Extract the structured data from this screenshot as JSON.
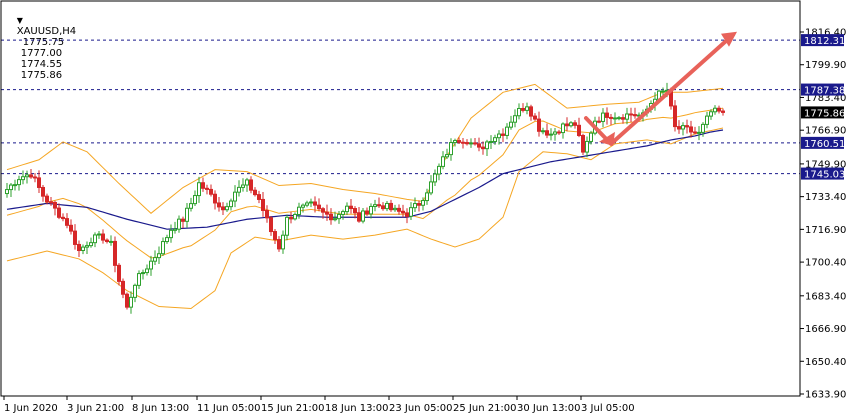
{
  "header": {
    "symbol": "XAUUSD,H4",
    "open": "1775.75",
    "high": "1777.00",
    "low": "1774.55",
    "close": "1775.86",
    "dropdown_glyph": "▼"
  },
  "colors": {
    "background": "#ffffff",
    "axis": "#000000",
    "bull": "#2ca02c",
    "bear": "#d62728",
    "bollinger": "#f5a623",
    "moving_average": "#1a1a8c",
    "level_line": "#1a1a8c",
    "level_label_bg": "#1a1a8c",
    "current_label_bg": "#000000",
    "arrow": "#e8625a"
  },
  "chart_data": {
    "type": "candlestick",
    "symbol": "XAUUSD",
    "timeframe": "H4",
    "ylim": [
      1633.9,
      1816.4
    ],
    "y_ticks": [
      "1816.40",
      "1799.90",
      "1783.40",
      "1766.90",
      "1749.90",
      "1733.40",
      "1716.90",
      "1700.40",
      "1683.40",
      "1666.90",
      "1650.40",
      "1633.90"
    ],
    "x_ticks": [
      "1 Jun 2020",
      "3 Jun 21:00",
      "8 Jun 13:00",
      "11 Jun 05:00",
      "15 Jun 21:00",
      "18 Jun 13:00",
      "23 Jun 05:00",
      "25 Jun 21:00",
      "30 Jun 13:00",
      "3 Jul 05:00"
    ],
    "levels": [
      {
        "value": 1812.31,
        "label": "1812.31"
      },
      {
        "value": 1787.38,
        "label": "1787.38"
      },
      {
        "value": 1760.51,
        "label": "1760.51"
      },
      {
        "value": 1745.03,
        "label": "1745.03"
      }
    ],
    "current_price": {
      "value": 1775.86,
      "label": "1775.86"
    },
    "close_anchors": [
      [
        0,
        1737
      ],
      [
        3,
        1743
      ],
      [
        6,
        1745
      ],
      [
        9,
        1734
      ],
      [
        12,
        1727
      ],
      [
        15,
        1720
      ],
      [
        18,
        1706
      ],
      [
        21,
        1712
      ],
      [
        24,
        1713
      ],
      [
        26,
        1709
      ],
      [
        28,
        1691
      ],
      [
        30,
        1677
      ],
      [
        32,
        1690
      ],
      [
        35,
        1698
      ],
      [
        38,
        1706
      ],
      [
        41,
        1717
      ],
      [
        44,
        1722
      ],
      [
        46,
        1730
      ],
      [
        48,
        1740
      ],
      [
        51,
        1734
      ],
      [
        54,
        1727
      ],
      [
        57,
        1736
      ],
      [
        60,
        1740
      ],
      [
        63,
        1732
      ],
      [
        66,
        1716
      ],
      [
        68,
        1708
      ],
      [
        70,
        1722
      ],
      [
        73,
        1727
      ],
      [
        76,
        1729
      ],
      [
        79,
        1725
      ],
      [
        82,
        1723
      ],
      [
        85,
        1729
      ],
      [
        88,
        1722
      ],
      [
        91,
        1729
      ],
      [
        94,
        1729
      ],
      [
        97,
        1726
      ],
      [
        100,
        1725
      ],
      [
        103,
        1730
      ],
      [
        106,
        1740
      ],
      [
        109,
        1752
      ],
      [
        112,
        1763
      ],
      [
        115,
        1762
      ],
      [
        118,
        1757
      ],
      [
        121,
        1763
      ],
      [
        124,
        1766
      ],
      [
        127,
        1775
      ],
      [
        130,
        1780
      ],
      [
        133,
        1768
      ],
      [
        136,
        1765
      ],
      [
        139,
        1769
      ],
      [
        142,
        1770
      ],
      [
        144,
        1755
      ],
      [
        147,
        1772
      ],
      [
        150,
        1775
      ],
      [
        153,
        1774
      ],
      [
        156,
        1775
      ],
      [
        159,
        1774
      ],
      [
        162,
        1784
      ],
      [
        165,
        1787
      ],
      [
        167,
        1768
      ],
      [
        170,
        1767
      ],
      [
        173,
        1765
      ],
      [
        176,
        1776
      ],
      [
        179,
        1776
      ]
    ],
    "bollinger_upper_anchors": [
      [
        0,
        1747
      ],
      [
        8,
        1752
      ],
      [
        14,
        1761
      ],
      [
        20,
        1756
      ],
      [
        28,
        1740
      ],
      [
        36,
        1725
      ],
      [
        44,
        1738
      ],
      [
        52,
        1747
      ],
      [
        60,
        1746
      ],
      [
        68,
        1739
      ],
      [
        76,
        1740
      ],
      [
        84,
        1737
      ],
      [
        92,
        1735
      ],
      [
        100,
        1732
      ],
      [
        104,
        1731
      ],
      [
        110,
        1754
      ],
      [
        116,
        1773
      ],
      [
        124,
        1786
      ],
      [
        132,
        1790
      ],
      [
        140,
        1778
      ],
      [
        150,
        1780
      ],
      [
        158,
        1781
      ],
      [
        164,
        1786
      ],
      [
        170,
        1786
      ],
      [
        179,
        1788
      ]
    ],
    "bollinger_lower_anchors": [
      [
        0,
        1701
      ],
      [
        10,
        1706
      ],
      [
        18,
        1702
      ],
      [
        24,
        1695
      ],
      [
        30,
        1686
      ],
      [
        38,
        1678
      ],
      [
        46,
        1677
      ],
      [
        52,
        1686
      ],
      [
        56,
        1705
      ],
      [
        62,
        1713
      ],
      [
        68,
        1711
      ],
      [
        76,
        1714
      ],
      [
        84,
        1712
      ],
      [
        92,
        1714
      ],
      [
        100,
        1717
      ],
      [
        106,
        1712
      ],
      [
        112,
        1708
      ],
      [
        118,
        1712
      ],
      [
        124,
        1723
      ],
      [
        128,
        1746
      ],
      [
        134,
        1756
      ],
      [
        140,
        1755
      ],
      [
        146,
        1752
      ],
      [
        152,
        1760
      ],
      [
        160,
        1762
      ],
      [
        166,
        1760
      ],
      [
        172,
        1765
      ],
      [
        179,
        1768
      ]
    ],
    "moving_average_anchors": [
      [
        0,
        1727
      ],
      [
        10,
        1730
      ],
      [
        20,
        1728
      ],
      [
        30,
        1722
      ],
      [
        40,
        1717
      ],
      [
        50,
        1718
      ],
      [
        60,
        1722
      ],
      [
        70,
        1724
      ],
      [
        80,
        1723
      ],
      [
        90,
        1723
      ],
      [
        100,
        1723
      ],
      [
        106,
        1726
      ],
      [
        112,
        1732
      ],
      [
        118,
        1738
      ],
      [
        124,
        1745
      ],
      [
        130,
        1748
      ],
      [
        136,
        1751
      ],
      [
        142,
        1753
      ],
      [
        148,
        1755
      ],
      [
        154,
        1757
      ],
      [
        160,
        1759
      ],
      [
        166,
        1762
      ],
      [
        172,
        1764
      ],
      [
        176,
        1766
      ],
      [
        179,
        1767
      ]
    ],
    "projection_arrow": [
      [
        1775,
        1773
      ],
      [
        1760,
        1760
      ],
      [
        1815,
        1815
      ]
    ]
  }
}
